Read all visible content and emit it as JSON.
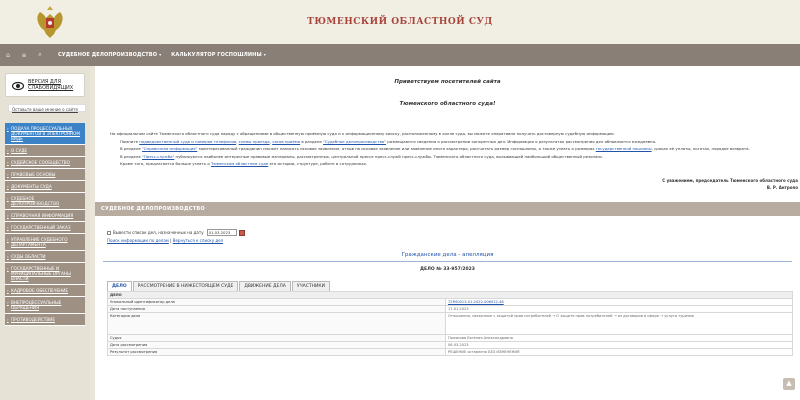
{
  "header": {
    "title": "ТЮМЕНСКИЙ ОБЛАСТНОЙ СУД"
  },
  "nav": {
    "home_icon": "home-icon",
    "map_icon": "sitemap-icon",
    "search_icon": "search-icon",
    "items": [
      {
        "label": "СУДЕБНОЕ ДЕЛОПРОИЗВОДСТВО"
      },
      {
        "label": "КАЛЬКУЛЯТОР ГОСПОШЛИНЫ"
      }
    ]
  },
  "sidebar": {
    "accessibility_label": "ВЕРСИЯ ДЛЯ СЛАБОВИДЯЩИХ",
    "feedback_label": "Оставьте ваше мнение о сайте",
    "items": [
      {
        "label": "ПОДАЧА ПРОЦЕССУАЛЬНЫХ ДОКУМЕНТОВ В ЭЛЕКТРОННОМ ВИДЕ",
        "active": true
      },
      {
        "label": "О СУДЕ",
        "active": false
      },
      {
        "label": "СУДЕЙСКОЕ СООБЩЕСТВО",
        "active": false
      },
      {
        "label": "ПРАВОВЫЕ ОСНОВЫ",
        "active": false
      },
      {
        "label": "ДОКУМЕНТЫ СУДА",
        "active": false
      },
      {
        "label": "СУДЕБНОЕ ДЕЛОПРОИЗВОДСТВО",
        "active": false
      },
      {
        "label": "СПРАВОЧНАЯ ИНФОРМАЦИЯ",
        "active": false
      },
      {
        "label": "ГОСУДАРСТВЕННЫЙ ЗАКАЗ",
        "active": false
      },
      {
        "label": "УПРАВЛЕНИЕ СУДЕБНОГО ДЕПАРТАМЕНТА",
        "active": false
      },
      {
        "label": "СУДЫ ОБЛАСТИ",
        "active": false
      },
      {
        "label": "ГОСУДАРСТВЕННЫЕ И МУНИЦИПАЛЬНЫЕ ОРГАНЫ ВЛАСТИ",
        "active": false
      },
      {
        "label": "КАДРОВОЕ ОБЕСПЕЧЕНИЕ",
        "active": false
      },
      {
        "label": "ВНЕПРОЦЕССУАЛЬНЫЕ ОБРАЩЕНИЯ",
        "active": false
      },
      {
        "label": "ПРОТИВОДЕЙСТВИЕ",
        "active": false
      }
    ]
  },
  "main": {
    "greeting_line1": "Приветствуем посетителей сайта",
    "greeting_line2": "Тюменского областного суда!",
    "intro": {
      "p1": "На официальном сайте Тюменского областного суда наряду с обращениями в общественную приёмную суда и к информационному киоску, расположенному в холле суда, вы можете оперативно получать достоверную судебную информацию.",
      "p2_a": "Помните ",
      "p2_link1": "подведомственный суда и номеров телефонов",
      "p2_b": ", ",
      "p2_link2": "схемы проезда",
      "p2_c": ", ",
      "p2_link3": "часов приёма",
      "p2_d": " в разделе ",
      "p2_link4": "\"Судебное делопроизводство\"",
      "p2_e": " размещаются сведения о рассмотрении конкретных дел. Информация о результатах рассмотрения дел обновляется ежедневно.",
      "p3_a": "В разделе ",
      "p3_link1": "\"Справочная информация\"",
      "p3_b": " заинтересованный гражданин сможет написать исковое заявление, отзыв на исковое заявление или заявление иного характера, рассчитать размер госпошлины, а также узнать о размерах ",
      "p3_link2": "государственной пошлины",
      "p3_c": ", сроках её уплаты, льготах, порядке возврата.",
      "p4_a": "В разделе ",
      "p4_link1": "\"Пресс-служба\"",
      "p4_b": " публикуются наиболее интересные правовые материалы, рассмотренных, центральной прессе пресс-служб пресс-службы. Тюменского областного суда, вызывающей наибольший общественный резонанс.",
      "p5_a": "Кроме того, предлагается больше узнать о ",
      "p5_link1": "Тюменском областном суде",
      "p5_b": " его истории, структуре, работе и сотрудниках."
    },
    "signature_line1": "С уважением, председатель Тюменского областного суда",
    "signature_line2": "В. Р. Антропо",
    "section_title": "СУДЕБНОЕ ДЕЛОПРОИЗВОДСТВО",
    "filter": {
      "label": "Вывести список дел, назначенных на дату",
      "date_value": "01.03.2023",
      "link_search": "Поиск информации по делам",
      "separator": " | ",
      "link_back": "Вернуться к списку дел"
    },
    "case_category": "Гражданские дела - апелляция",
    "case_number": "ДЕЛО № 33-957/2023",
    "tabs": [
      {
        "label": "ДЕЛО",
        "active": true
      },
      {
        "label": "РАССМОТРЕНИЕ В НИЖЕСТОЯЩЕМ СУДЕ",
        "active": false
      },
      {
        "label": "ДВИЖЕНИЕ ДЕЛА",
        "active": false
      },
      {
        "label": "УЧАСТНИКИ",
        "active": false
      }
    ],
    "table": {
      "header": "ДЕЛО",
      "rows": [
        {
          "label": "Уникальный идентификатор дела",
          "value": "72RS0013-01-2022-006012-48",
          "link": true
        },
        {
          "label": "Дата поступления",
          "value": "17.01.2023",
          "link": false
        },
        {
          "label": "Категория дела",
          "value": "Отношения, связанные с защитой прав потребителей → О защите прав потребителей → из договоров в сфере → услуги туризма",
          "link": false
        },
        {
          "label": "Судья",
          "value": "Полякова Евгения Александровна",
          "link": false
        },
        {
          "label": "Дата рассмотрения",
          "value": "06.03.2023",
          "link": false
        },
        {
          "label": "Результат рассмотрения",
          "value": "РЕШЕНИЕ оставлено БЕЗ ИЗМЕНЕНИЯ",
          "link": false
        }
      ]
    }
  },
  "colors": {
    "title_red": "#a8443a",
    "nav_bg": "#8a7f76",
    "sidebar_item": "#9e9184",
    "sidebar_active": "#3b82c6",
    "section_bar": "#b8aba0",
    "link_blue": "#2255aa"
  },
  "scroll_icon": "arrow-up-icon"
}
